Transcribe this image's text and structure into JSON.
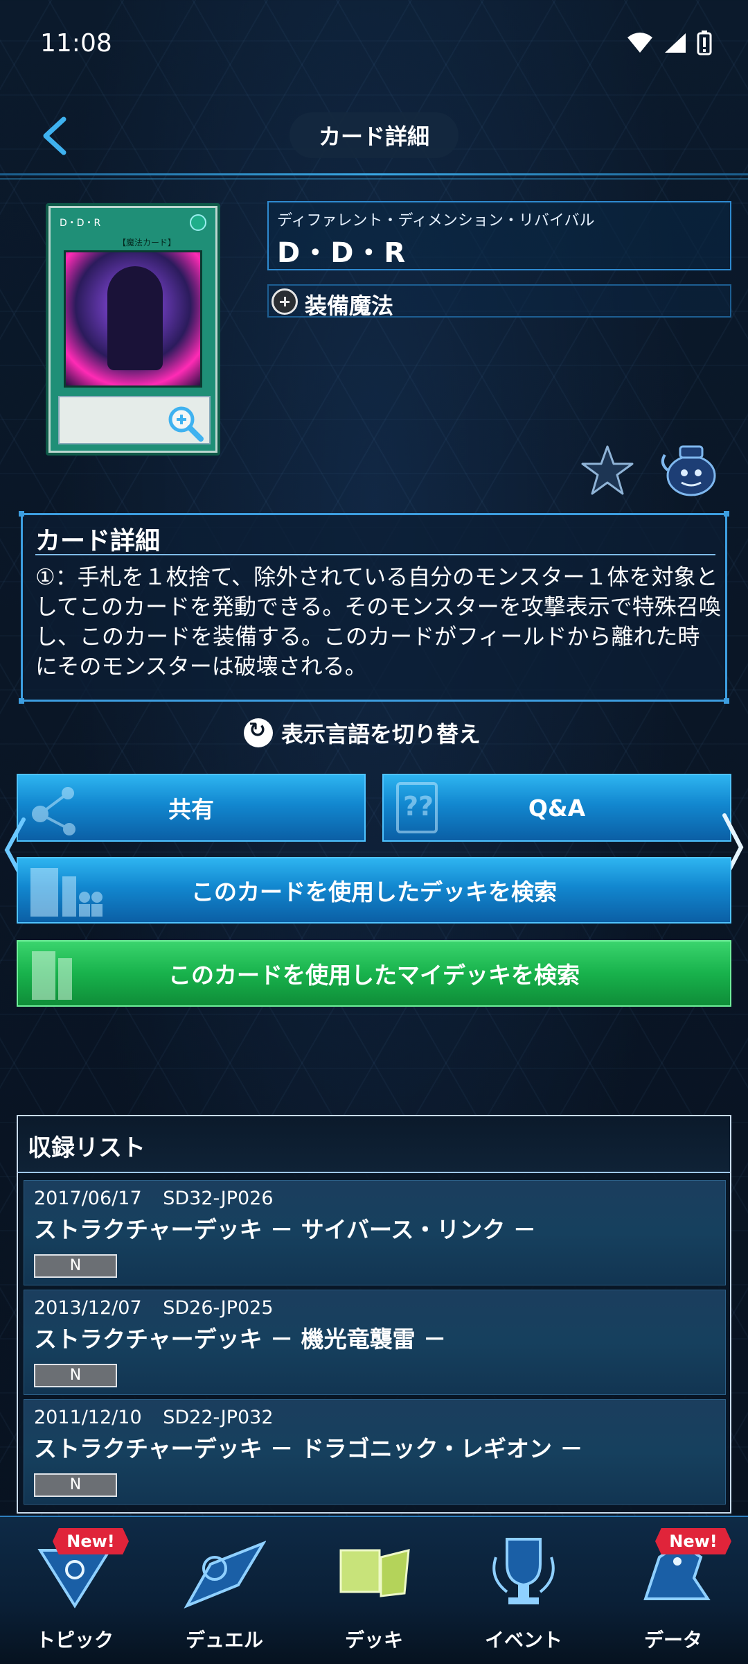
{
  "status": {
    "time": "11:08"
  },
  "header": {
    "title": "カード詳細"
  },
  "card": {
    "image_name": "D・D・R",
    "image_type": "【魔法カード】",
    "ruby": "ディファレント・ディメンション・リバイバル",
    "name": "D・D・R",
    "type": "装備魔法"
  },
  "description": {
    "title": "カード詳細",
    "text": "①：手札を１枚捨て、除外されている自分のモンスター１体を対象としてこのカードを発動できる。そのモンスターを攻撃表示で特殊召喚し、このカードを装備する。このカードがフィールドから離れた時にそのモンスターは破壊される。"
  },
  "language_toggle": "表示言語を切り替え",
  "buttons": {
    "share": "共有",
    "qa": "Q&A",
    "deck_search": "このカードを使用したデッキを検索",
    "mydeck_search": "このカードを使用したマイデッキを検索"
  },
  "list": {
    "title": "収録リスト",
    "rows": [
      {
        "date": "2017/06/17",
        "code": "SD32-JP026",
        "title": "ストラクチャーデッキ － サイバース・リンク －",
        "rarity": "N"
      },
      {
        "date": "2013/12/07",
        "code": "SD26-JP025",
        "title": "ストラクチャーデッキ － 機光竜襲雷 －",
        "rarity": "N"
      },
      {
        "date": "2011/12/10",
        "code": "SD22-JP032",
        "title": "ストラクチャーデッキ － ドラゴニック・レギオン －",
        "rarity": "N"
      }
    ]
  },
  "nav": {
    "items": [
      {
        "label": "トピック",
        "badge": "New!"
      },
      {
        "label": "デュエル",
        "badge": ""
      },
      {
        "label": "デッキ",
        "badge": ""
      },
      {
        "label": "イベント",
        "badge": ""
      },
      {
        "label": "データ",
        "badge": "New!"
      }
    ]
  },
  "colors": {
    "accent": "#3d9ee0",
    "button_blue": "#1287cf",
    "button_green": "#18b24c",
    "badge_red": "#e0243a"
  }
}
